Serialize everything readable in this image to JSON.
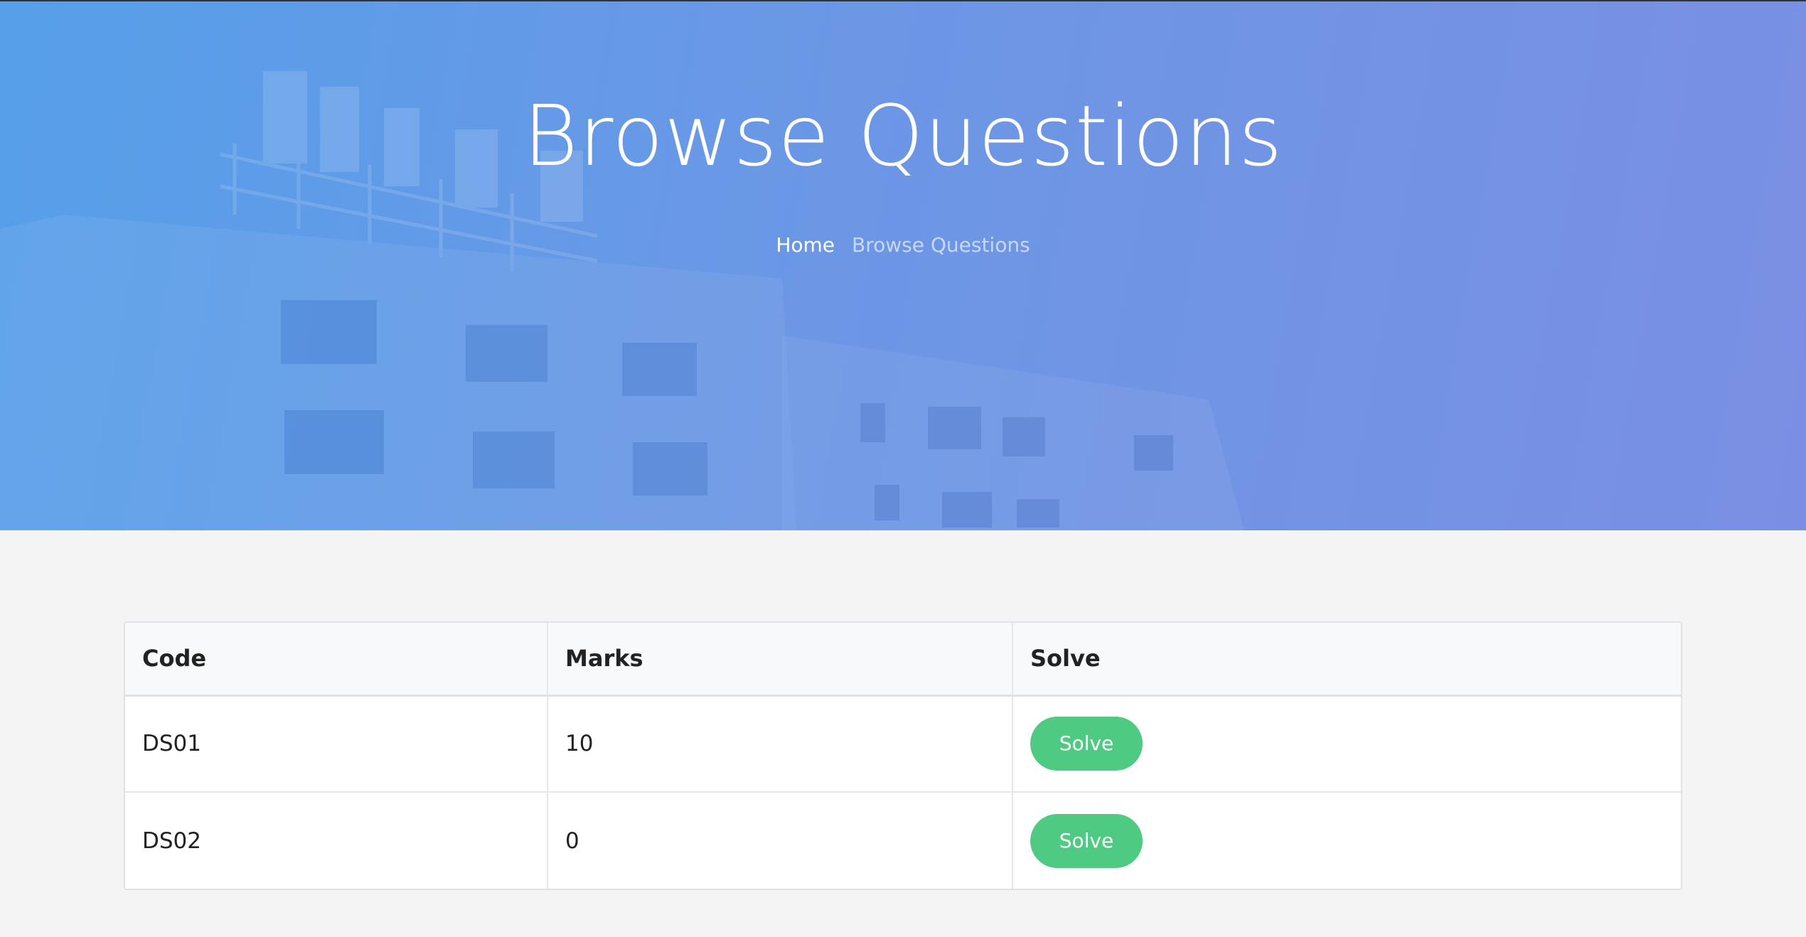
{
  "hero": {
    "title": "Browse Questions",
    "breadcrumb": {
      "home": "Home",
      "current": "Browse Questions"
    }
  },
  "table": {
    "headers": {
      "code": "Code",
      "marks": "Marks",
      "solve": "Solve"
    },
    "rows": [
      {
        "code": "DS01",
        "marks": "10",
        "action": "Solve"
      },
      {
        "code": "DS02",
        "marks": "0",
        "action": "Solve"
      }
    ]
  },
  "colors": {
    "hero_gradient_start": "#569fe9",
    "hero_gradient_end": "#7a8fe3",
    "solve_button": "#4fca83",
    "page_background": "#f4f4f4"
  }
}
